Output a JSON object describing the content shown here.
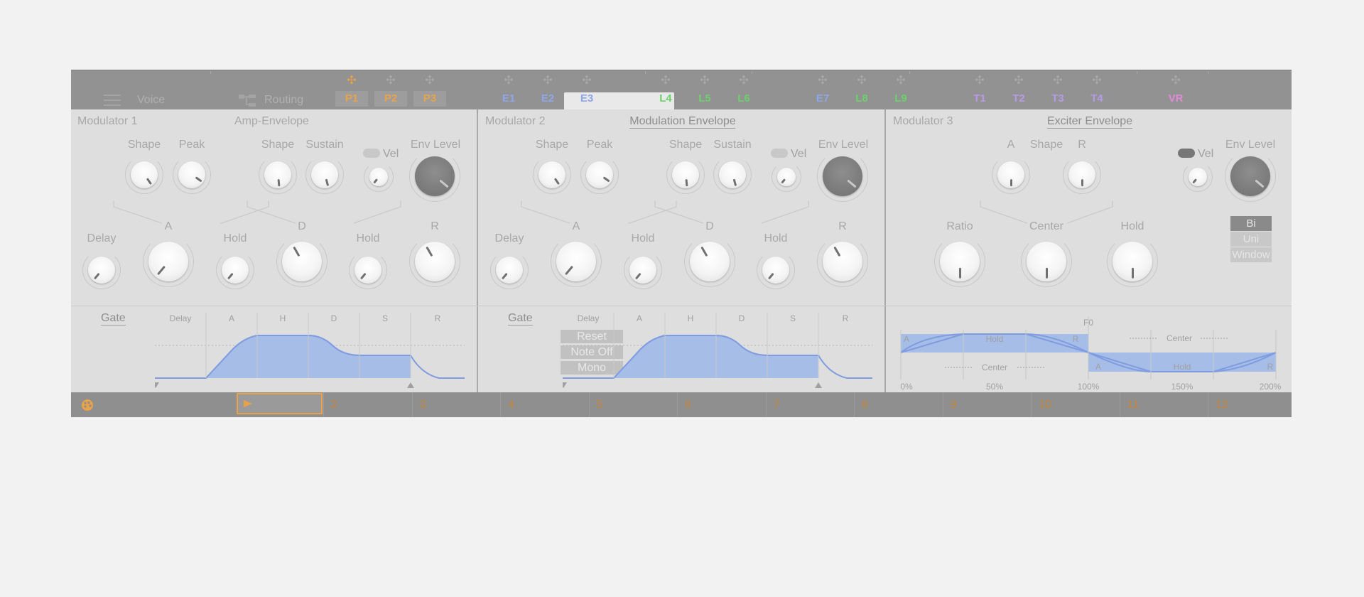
{
  "topbar": {
    "voice_label": "Voice",
    "routing_label": "Routing",
    "macros": [
      {
        "label": "P1",
        "color": "#e8a24a"
      },
      {
        "label": "P2",
        "color": "#e8a24a"
      },
      {
        "label": "P3",
        "color": "#e8a24a"
      },
      {
        "label": "E1",
        "color": "#8ea7e8"
      },
      {
        "label": "E2",
        "color": "#8ea7e8"
      },
      {
        "label": "E3",
        "color": "#8ea7e8"
      },
      {
        "label": "L4",
        "color": "#6cd06c"
      },
      {
        "label": "L5",
        "color": "#6cd06c"
      },
      {
        "label": "L6",
        "color": "#6cd06c"
      },
      {
        "label": "E7",
        "color": "#8ea7e8"
      },
      {
        "label": "L8",
        "color": "#6cd06c"
      },
      {
        "label": "L9",
        "color": "#6cd06c"
      },
      {
        "label": "T1",
        "color": "#b69ae8"
      },
      {
        "label": "T2",
        "color": "#b69ae8"
      },
      {
        "label": "T3",
        "color": "#b69ae8"
      },
      {
        "label": "T4",
        "color": "#b69ae8"
      },
      {
        "label": "VR",
        "color": "#e08ad8"
      }
    ],
    "move_icon": "✣"
  },
  "modulators": [
    {
      "name": "Modulator 1",
      "title": "Amp-Envelope",
      "shape": "Shape",
      "peak": "Peak",
      "shape2": "Shape",
      "sustain": "Sustain",
      "vel": "Vel",
      "env_level": "Env Level",
      "a": "A",
      "d": "D",
      "r": "R",
      "delay": "Delay",
      "hold1": "Hold",
      "hold2": "Hold"
    },
    {
      "name": "Modulator 2",
      "title": "Modulation Envelope",
      "shape": "Shape",
      "peak": "Peak",
      "shape2": "Shape",
      "sustain": "Sustain",
      "vel": "Vel",
      "env_level": "Env Level",
      "a": "A",
      "d": "D",
      "r": "R",
      "delay": "Delay",
      "hold1": "Hold",
      "hold2": "Hold"
    },
    {
      "name": "Modulator 3",
      "title": "Exciter Envelope",
      "a": "A",
      "shape": "Shape",
      "r": "R",
      "vel": "Vel",
      "env_level": "Env Level",
      "ratio": "Ratio",
      "center": "Center",
      "hold": "Hold",
      "modes": [
        "Bi",
        "Uni",
        "Window"
      ]
    }
  ],
  "gate": {
    "label": "Gate",
    "buttons": [
      "Reset",
      "Note Off",
      "Mono"
    ]
  },
  "graph1": {
    "sections": [
      "Delay",
      "A",
      "H",
      "D",
      "S",
      "R"
    ]
  },
  "graph3": {
    "top": [
      "A",
      "Hold",
      "R"
    ],
    "bottom": [
      "A",
      "Hold",
      "R"
    ],
    "f0": "F0",
    "center": "Center",
    "ticks": [
      "0%",
      "50%",
      "100%",
      "150%",
      "200%"
    ]
  },
  "tracks": [
    "2",
    "3",
    "4",
    "5",
    "6",
    "7",
    "8",
    "9",
    "10",
    "11",
    "12"
  ],
  "colors": {
    "accent": "#e8a24a",
    "env_fill": "#a6bde8",
    "env_line": "#7f9ce0"
  }
}
